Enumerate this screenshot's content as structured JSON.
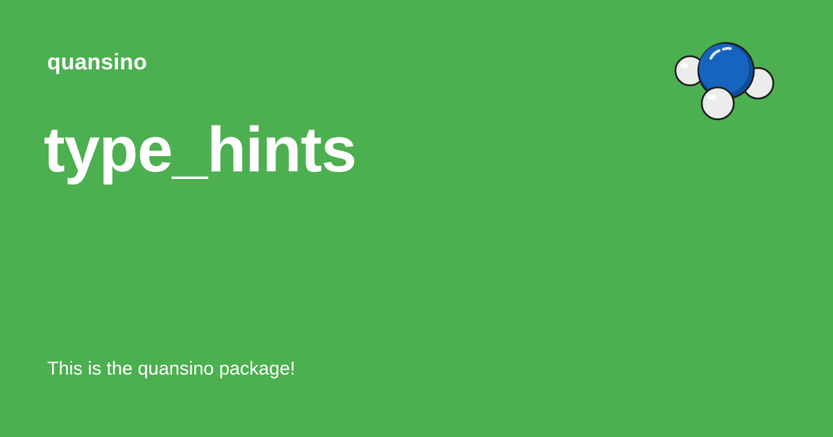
{
  "card": {
    "site_name": "quansino",
    "title": "type_hints",
    "description": "This is the quansino package!",
    "logo_icon": "molecule-icon",
    "colors": {
      "background": "#4caf50",
      "text": "#ffffff",
      "atom_center": "#1565c0",
      "atom_outer": "#ececec"
    }
  }
}
